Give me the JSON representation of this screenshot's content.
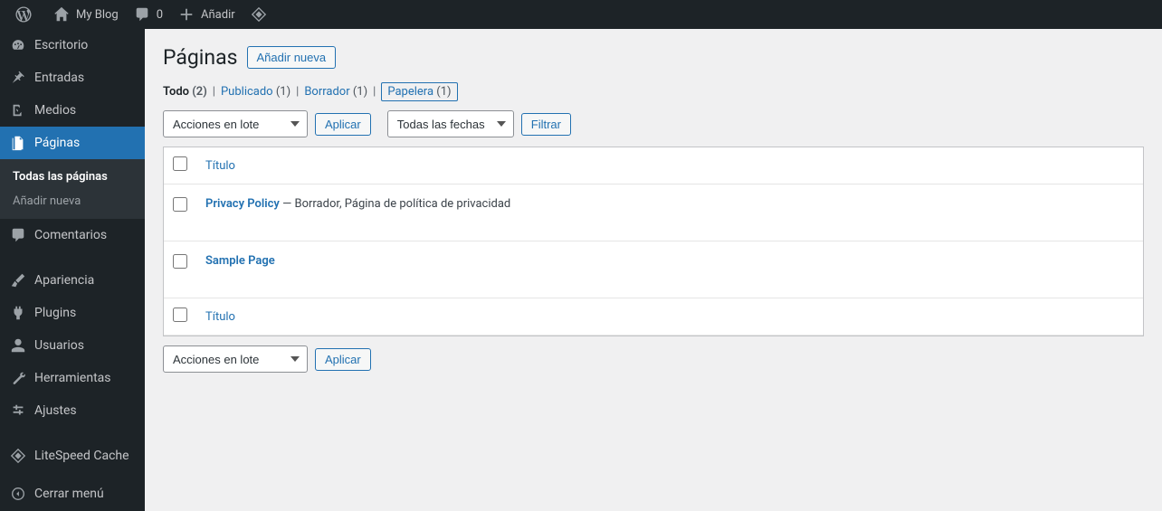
{
  "adminbar": {
    "site_name": "My Blog",
    "comments_count": "0",
    "new_label": "Añadir"
  },
  "sidebar": {
    "items": [
      {
        "label": "Escritorio",
        "icon": "dashboard"
      },
      {
        "label": "Entradas",
        "icon": "pin"
      },
      {
        "label": "Medios",
        "icon": "media"
      },
      {
        "label": "Páginas",
        "icon": "page",
        "current": true
      },
      {
        "label": "Comentarios",
        "icon": "comment"
      },
      {
        "label": "Apariencia",
        "icon": "brush"
      },
      {
        "label": "Plugins",
        "icon": "plug"
      },
      {
        "label": "Usuarios",
        "icon": "user"
      },
      {
        "label": "Herramientas",
        "icon": "tool"
      },
      {
        "label": "Ajustes",
        "icon": "settings"
      },
      {
        "label": "LiteSpeed Cache",
        "icon": "litespeed"
      }
    ],
    "submenu": [
      {
        "label": "Todas las páginas",
        "current": true
      },
      {
        "label": "Añadir nueva"
      }
    ],
    "collapse_label": "Cerrar menú"
  },
  "header": {
    "title": "Páginas",
    "add_new": "Añadir nueva"
  },
  "filters": {
    "all_label": "Todo",
    "all_count": "(2)",
    "published_label": "Publicado",
    "published_count": "(1)",
    "draft_label": "Borrador",
    "draft_count": "(1)",
    "trash_label": "Papelera",
    "trash_count": "(1)"
  },
  "bulk": {
    "actions_label": "Acciones en lote",
    "apply_label": "Aplicar",
    "date_filter_label": "Todas las fechas",
    "filter_label": "Filtrar"
  },
  "table": {
    "col_title": "Título",
    "rows": [
      {
        "title": "Privacy Policy",
        "state": " — Borrador, Página de política de privacidad"
      },
      {
        "title": "Sample Page",
        "state": ""
      }
    ]
  }
}
